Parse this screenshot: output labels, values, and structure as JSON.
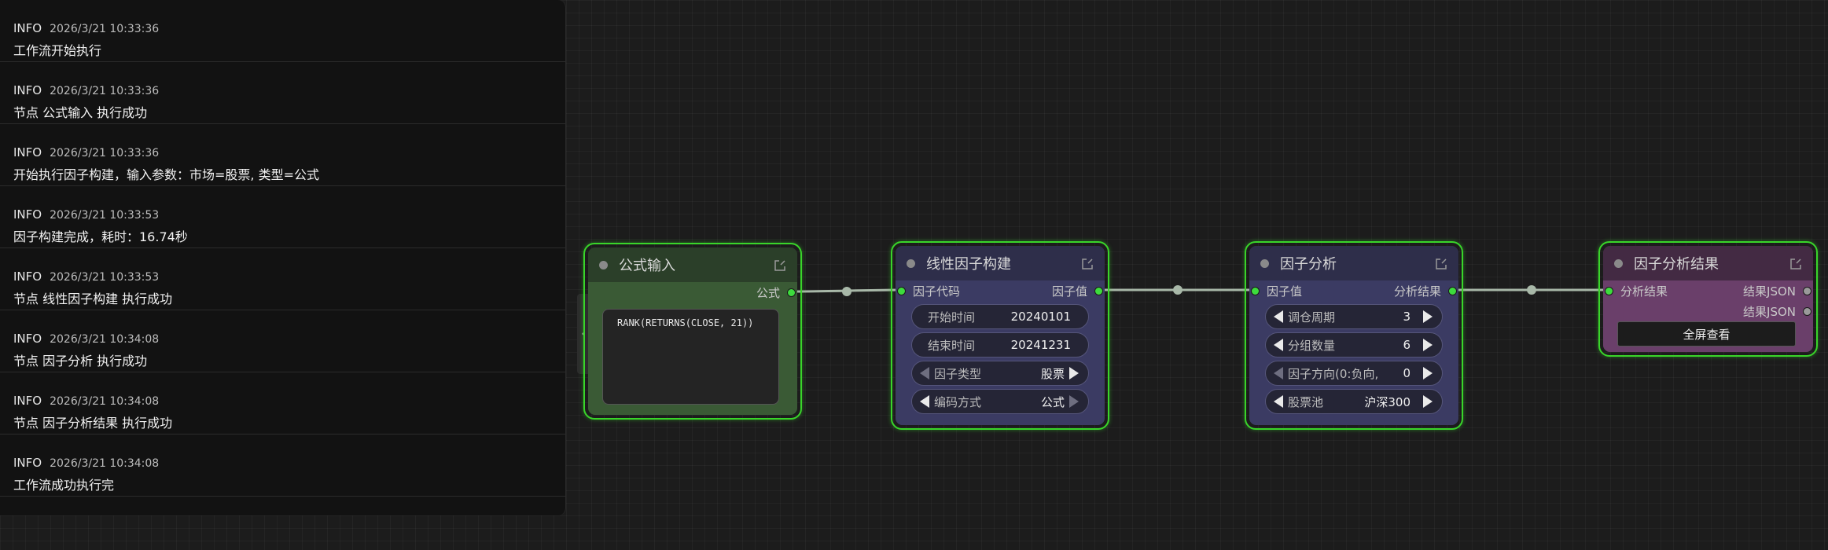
{
  "logs": [
    {
      "level": "INFO",
      "time": "2026/3/21 10:33:36",
      "message": "工作流开始执行"
    },
    {
      "level": "INFO",
      "time": "2026/3/21 10:33:36",
      "message": "节点 公式输入 执行成功"
    },
    {
      "level": "INFO",
      "time": "2026/3/21 10:33:36",
      "message": "开始执行因子构建，输入参数：市场=股票, 类型=公式"
    },
    {
      "level": "INFO",
      "time": "2026/3/21 10:33:53",
      "message": "因子构建完成，耗时：16.74秒"
    },
    {
      "level": "INFO",
      "time": "2026/3/21 10:33:53",
      "message": "节点 线性因子构建 执行成功"
    },
    {
      "level": "INFO",
      "time": "2026/3/21 10:34:08",
      "message": "节点 因子分析 执行成功"
    },
    {
      "level": "INFO",
      "time": "2026/3/21 10:34:08",
      "message": "节点 因子分析结果 执行成功"
    },
    {
      "level": "INFO",
      "time": "2026/3/21 10:34:08",
      "message": "工作流成功执行完"
    }
  ],
  "collapse_glyph": "‹",
  "nodes": {
    "formula_input": {
      "title": "公式输入",
      "output_label": "公式",
      "formula": "RANK(RETURNS(CLOSE, 21))"
    },
    "linear_factor": {
      "title": "线性因子构建",
      "input_label": "因子代码",
      "output_label": "因子值",
      "widgets": [
        {
          "label": "开始时间",
          "value": "20240101"
        },
        {
          "label": "结束时间",
          "value": "20241231"
        },
        {
          "label": "因子类型",
          "value": "股票"
        },
        {
          "label": "编码方式",
          "value": "公式"
        }
      ]
    },
    "factor_analysis": {
      "title": "因子分析",
      "input_label": "因子值",
      "output_label": "分析结果",
      "widgets": [
        {
          "label": "调仓周期",
          "value": "3"
        },
        {
          "label": "分组数量",
          "value": "6"
        },
        {
          "label": "因子方向(0:负向,",
          "value": "0"
        },
        {
          "label": "股票池",
          "value": "沪深300"
        }
      ]
    },
    "factor_result": {
      "title": "因子分析结果",
      "input_label": "分析结果",
      "output_label_1": "结果JSON",
      "output_label_2": "结果JSON",
      "button_label": "全屏查看"
    }
  },
  "colors": {
    "node_border": "#39d52a",
    "formula_bg": "#3a5a35",
    "linear_bg": "#3b3b63",
    "result_bg": "#6a3f6a",
    "wire": "#a8b8a8"
  }
}
